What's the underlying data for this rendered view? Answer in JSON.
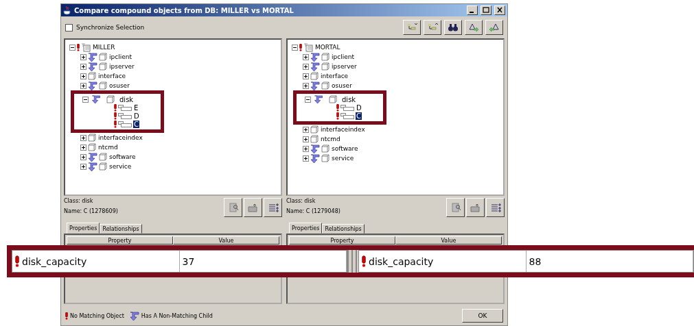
{
  "window": {
    "title": "Compare compound objects from DB: MILLER vs MORTAL"
  },
  "sync_checkbox": {
    "label": "Synchronize Selection",
    "checked": false
  },
  "panels": [
    {
      "tree": {
        "label": "MILLER",
        "kind": "root",
        "expanded": true,
        "no_match": true,
        "children": [
          {
            "label": "ipclient",
            "kind": "folder",
            "expanded": false,
            "child_mismatch": true
          },
          {
            "label": "ipserver",
            "kind": "folder",
            "expanded": false,
            "child_mismatch": true
          },
          {
            "label": "interface",
            "kind": "folder",
            "expanded": false,
            "child_mismatch": false
          },
          {
            "label": "osuser",
            "kind": "folder",
            "expanded": false,
            "child_mismatch": true
          },
          {
            "label": "disk",
            "kind": "folder",
            "expanded": true,
            "child_mismatch": true,
            "callout": true,
            "children": [
              {
                "label": "E",
                "kind": "item",
                "no_match": true,
                "selected": false
              },
              {
                "label": "D",
                "kind": "item",
                "no_match": true,
                "selected": false
              },
              {
                "label": "C",
                "kind": "item",
                "no_match": true,
                "selected": true
              }
            ]
          },
          {
            "label": "interfaceindex",
            "kind": "folder",
            "expanded": false,
            "child_mismatch": false
          },
          {
            "label": "ntcmd",
            "kind": "folder",
            "expanded": false,
            "child_mismatch": false
          },
          {
            "label": "software",
            "kind": "folder",
            "expanded": false,
            "child_mismatch": true
          },
          {
            "label": "service",
            "kind": "folder",
            "expanded": false,
            "child_mismatch": true
          }
        ]
      },
      "class": "Class: disk",
      "name": "Name: C (1278609)",
      "tabs": [
        {
          "label": "Properties",
          "selected": true
        },
        {
          "label": "Relationships",
          "selected": false
        }
      ],
      "columns": [
        "Property",
        "Value"
      ],
      "zoom_row": {
        "property": "disk_capacity",
        "value": "37",
        "no_match": true
      }
    },
    {
      "tree": {
        "label": "MORTAL",
        "kind": "root",
        "expanded": true,
        "no_match": true,
        "children": [
          {
            "label": "ipclient",
            "kind": "folder",
            "expanded": false,
            "child_mismatch": true
          },
          {
            "label": "ipserver",
            "kind": "folder",
            "expanded": false,
            "child_mismatch": true
          },
          {
            "label": "interface",
            "kind": "folder",
            "expanded": false,
            "child_mismatch": false
          },
          {
            "label": "osuser",
            "kind": "folder",
            "expanded": false,
            "child_mismatch": true
          },
          {
            "label": "disk",
            "kind": "folder",
            "expanded": true,
            "child_mismatch": true,
            "callout": true,
            "children": [
              {
                "label": "D",
                "kind": "item",
                "no_match": true,
                "selected": false
              },
              {
                "label": "C",
                "kind": "item",
                "no_match": true,
                "selected": true
              }
            ]
          },
          {
            "label": "interfaceindex",
            "kind": "folder",
            "expanded": false,
            "child_mismatch": false
          },
          {
            "label": "ntcmd",
            "kind": "folder",
            "expanded": false,
            "child_mismatch": false
          },
          {
            "label": "software",
            "kind": "folder",
            "expanded": false,
            "child_mismatch": true
          },
          {
            "label": "service",
            "kind": "folder",
            "expanded": false,
            "child_mismatch": true
          }
        ]
      },
      "class": "Class: disk",
      "name": "Name: C (1279048)",
      "tabs": [
        {
          "label": "Properties",
          "selected": true
        },
        {
          "label": "Relationships",
          "selected": false
        }
      ],
      "columns": [
        "Property",
        "Value"
      ],
      "zoom_row": {
        "property": "disk_capacity",
        "value": "88",
        "no_match": true
      }
    }
  ],
  "legend": [
    {
      "kind": "no-match",
      "label": "No Matching Object"
    },
    {
      "kind": "non-matching-child",
      "label": "Has A Non-Matching Child"
    }
  ],
  "ok_button": "OK"
}
